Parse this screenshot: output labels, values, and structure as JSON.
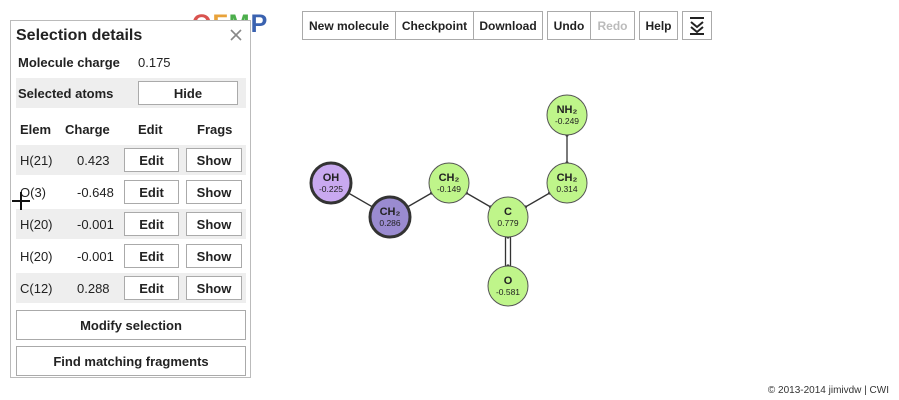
{
  "logo": {
    "c1": "O",
    "c2": "F",
    "c3": "M",
    "c4": "P"
  },
  "toolbar": {
    "new_molecule": "New molecule",
    "checkpoint": "Checkpoint",
    "download": "Download",
    "undo": "Undo",
    "redo": "Redo",
    "help": "Help",
    "menu_icon": "collapse-icon"
  },
  "panel": {
    "title": "Selection details",
    "close_icon": "close-icon",
    "molecule_charge_label": "Molecule charge",
    "molecule_charge_value": "0.175",
    "selected_atoms_label": "Selected atoms",
    "hide_button": "Hide",
    "columns": {
      "elem": "Elem",
      "charge": "Charge",
      "edit": "Edit",
      "frags": "Frags"
    },
    "atoms": [
      {
        "elem": "H(21)",
        "charge": "0.423",
        "edit": "Edit",
        "frags": "Show"
      },
      {
        "elem": "O(3)",
        "charge": "-0.648",
        "edit": "Edit",
        "frags": "Show"
      },
      {
        "elem": "H(20)",
        "charge": "-0.001",
        "edit": "Edit",
        "frags": "Show"
      },
      {
        "elem": "H(20)",
        "charge": "-0.001",
        "edit": "Edit",
        "frags": "Show"
      },
      {
        "elem": "C(12)",
        "charge": "0.288",
        "edit": "Edit",
        "frags": "Show"
      }
    ],
    "modify_button": "Modify selection",
    "find_button": "Find matching fragments"
  },
  "molecule": {
    "atoms": [
      {
        "label": "OH",
        "charge": "-0.225",
        "fill": "#c9a9f0",
        "selected": true
      },
      {
        "label": "CH₂",
        "charge": "0.286",
        "fill": "#9a8bd0",
        "selected": true
      },
      {
        "label": "CH₂",
        "charge": "-0.149",
        "fill": "#bff58a",
        "selected": false
      },
      {
        "label": "C",
        "charge": "0.779",
        "fill": "#bff58a",
        "selected": false
      },
      {
        "label": "O",
        "charge": "-0.581",
        "fill": "#bff58a",
        "selected": false
      },
      {
        "label": "CH₂",
        "charge": "0.314",
        "fill": "#bff58a",
        "selected": false
      },
      {
        "label": "NH₂",
        "charge": "-0.249",
        "fill": "#bff58a",
        "selected": false
      }
    ],
    "bonds": [
      [
        0,
        1,
        1
      ],
      [
        1,
        2,
        1
      ],
      [
        2,
        3,
        1
      ],
      [
        3,
        4,
        2
      ],
      [
        3,
        5,
        1
      ],
      [
        5,
        6,
        1
      ]
    ]
  },
  "footer": "© 2013-2014 jimivdw | CWI"
}
